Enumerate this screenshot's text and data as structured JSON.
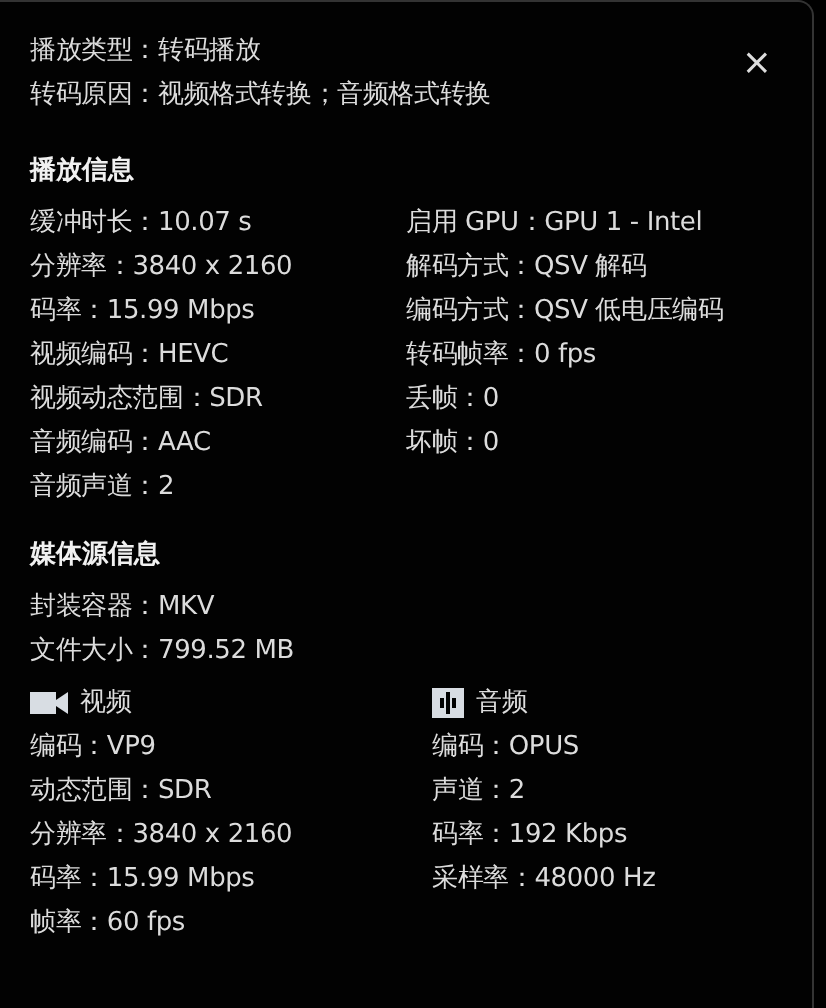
{
  "header": {
    "lines": [
      "播放类型：转码播放",
      "转码原因：视频格式转换；音频格式转换"
    ],
    "close": "×"
  },
  "playback": {
    "title": "播放信息",
    "left": [
      "缓冲时长：10.07 s",
      "分辨率：3840 x 2160",
      "码率：15.99 Mbps",
      "视频编码：HEVC",
      "视频动态范围：SDR",
      "音频编码：AAC",
      "音频声道：2"
    ],
    "right": [
      "启用 GPU：GPU 1 - Intel",
      "解码方式：QSV 解码",
      "编码方式：QSV 低电压编码",
      "转码帧率：0 fps",
      "丢帧：0",
      "坏帧：0"
    ]
  },
  "media": {
    "title": "媒体源信息",
    "lines": [
      "封装容器：MKV",
      "文件大小：799.52 MB"
    ],
    "streams": [
      {
        "kind": "video",
        "title": "视频",
        "lines": [
          "编码：VP9",
          "动态范围：SDR",
          "分辨率：3840 x 2160",
          "码率：15.99 Mbps",
          "帧率：60 fps"
        ]
      },
      {
        "kind": "audio",
        "title": "音频",
        "lines": [
          "编码：OPUS",
          "声道：2",
          "码率：192 Kbps",
          "采样率：48000 Hz"
        ]
      }
    ]
  }
}
